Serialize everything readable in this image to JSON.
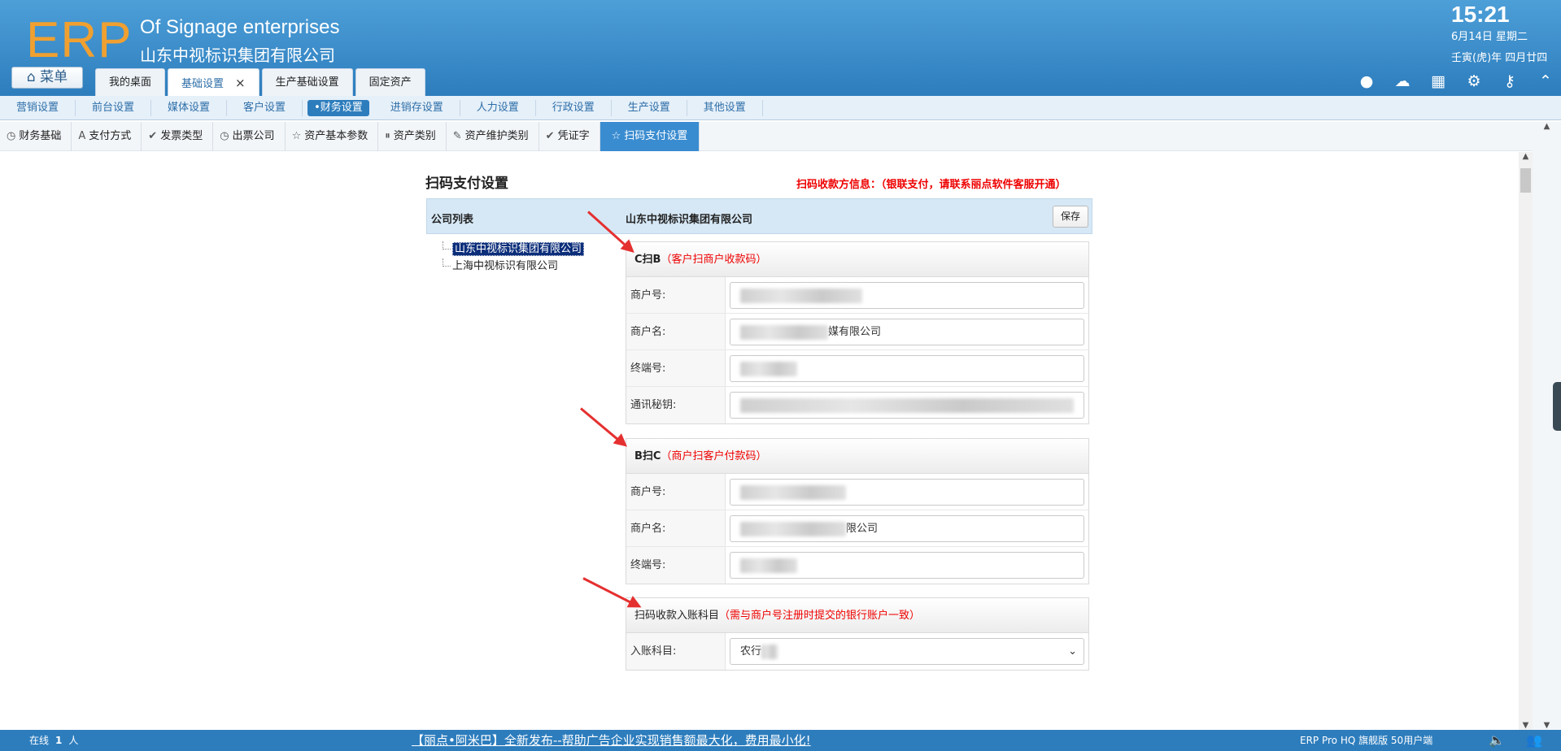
{
  "header": {
    "logo": "ERP",
    "company_en": "Of Signage enterprises",
    "company_cn": "山东中视标识集团有限公司",
    "time": "15:21",
    "date": "6月14日 星期二",
    "lunar": "壬寅(虎)年 四月廿四",
    "menu_label": "菜单",
    "tabs": [
      {
        "label": "我的桌面"
      },
      {
        "label": "基础设置",
        "close": "×"
      },
      {
        "label": "生产基础设置"
      },
      {
        "label": "固定资产"
      }
    ],
    "icons": [
      "user-icon",
      "cloud-icon",
      "grid-icon",
      "gear-icon",
      "key-icon",
      "collapse-icon"
    ]
  },
  "menubar": [
    "营销设置",
    "前台设置",
    "媒体设置",
    "客户设置",
    "•财务设置",
    "进销存设置",
    "人力设置",
    "行政设置",
    "生产设置",
    "其他设置"
  ],
  "subbar": [
    {
      "icon": "clock-icon",
      "glyph": "◷",
      "label": "财务基础"
    },
    {
      "icon": "letter-a-icon",
      "glyph": "A",
      "label": "支付方式"
    },
    {
      "icon": "check-icon",
      "glyph": "✔",
      "label": "发票类型"
    },
    {
      "icon": "clock-icon",
      "glyph": "◷",
      "label": "出票公司"
    },
    {
      "icon": "star-icon",
      "glyph": "☆",
      "label": "资产基本参数"
    },
    {
      "icon": "pause-icon",
      "glyph": "⏸",
      "label": "资产类别"
    },
    {
      "icon": "pencil-icon",
      "glyph": "✎",
      "label": "资产维护类别"
    },
    {
      "icon": "check-icon",
      "glyph": "✔",
      "label": "凭证字"
    },
    {
      "icon": "star-icon",
      "glyph": "☆",
      "label": "扫码支付设置"
    }
  ],
  "page": {
    "title": "扫码支付设置",
    "notice": "扫码收款方信息：（银联支付，请联系丽点软件客服开通）",
    "company_list_label": "公司列表",
    "selected_company": "山东中视标识集团有限公司",
    "save_label": "保存",
    "companies": [
      "山东中视标识集团有限公司",
      "上海中视标识有限公司"
    ]
  },
  "c2b": {
    "title": "C扫B",
    "hint": "（客户扫商户收款码）",
    "fields": [
      {
        "label": "商户号:",
        "value": ""
      },
      {
        "label": "商户名:",
        "value": "媒有限公司"
      },
      {
        "label": "终端号:",
        "value": ""
      },
      {
        "label": "通讯秘钥:",
        "value": ""
      }
    ]
  },
  "b2c": {
    "title": "B扫C",
    "hint": "（商户扫客户付款码）",
    "fields": [
      {
        "label": "商户号:",
        "value": ""
      },
      {
        "label": "商户名:",
        "value": "限公司"
      },
      {
        "label": "终端号:",
        "value": ""
      }
    ]
  },
  "account": {
    "title": "扫码收款入账科目",
    "hint": "（需与商户号注册时提交的银行账户一致）",
    "label": "入账科目:",
    "value": "农行"
  },
  "footer": {
    "online_prefix": "在线",
    "online_count": "1",
    "online_suffix": "人",
    "marquee": "【丽点•阿米巴】全新发布--帮助广告企业实现销售额最大化，费用最小化!",
    "version": "ERP Pro HQ 旗舰版 50用户端"
  },
  "colors": {
    "header": "#2d7dbd",
    "accent": "#3a8cd0",
    "logo": "#f0a030",
    "warning": "#e00000"
  }
}
